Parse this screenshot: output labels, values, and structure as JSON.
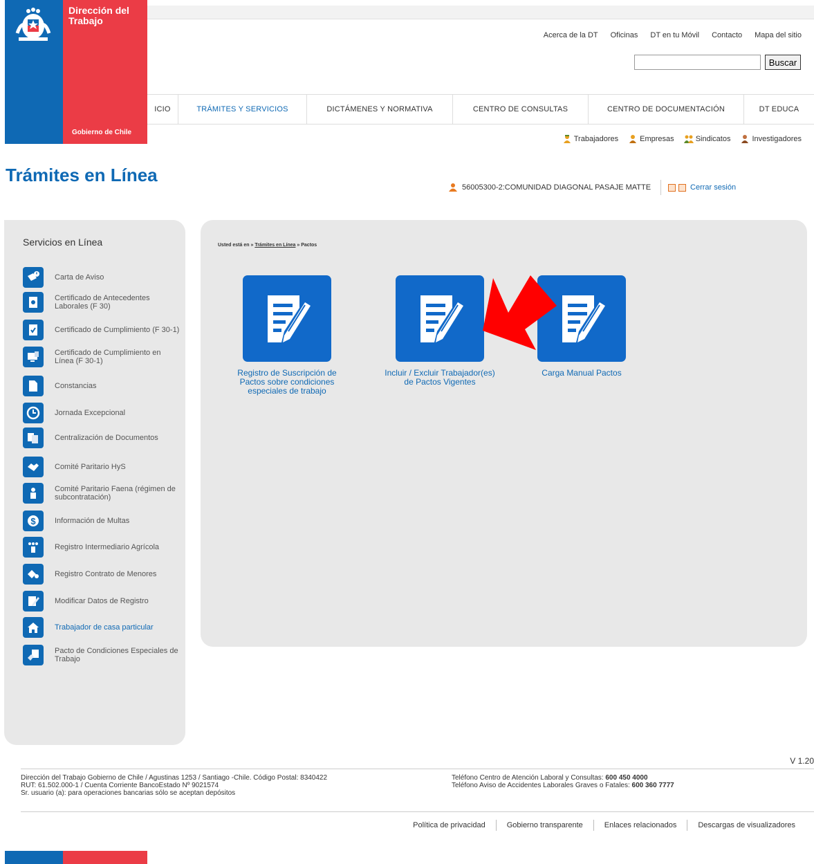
{
  "logo": {
    "line1": "Dirección del",
    "line2": "Trabajo",
    "bottom": "Gobierno de Chile"
  },
  "header": {
    "top_links": [
      "Acerca de la DT",
      "Oficinas",
      "DT en tu Móvil",
      "Contacto",
      "Mapa del sitio"
    ],
    "search": {
      "value": "",
      "button": "Buscar"
    },
    "nav": [
      {
        "label": "ICIO"
      },
      {
        "label": "TRÁMITES Y SERVICIOS"
      },
      {
        "label": "DICTÁMENES Y NORMATIVA"
      },
      {
        "label": "CENTRO DE CONSULTAS"
      },
      {
        "label": "CENTRO DE DOCUMENTACIÓN"
      },
      {
        "label": "DT EDUCA"
      }
    ],
    "audiences": [
      "Trabajadores",
      "Empresas",
      "Sindicatos",
      "Investigadores"
    ]
  },
  "page": {
    "title": "Trámites en Línea",
    "user": "56005300-2:COMUNIDAD DIAGONAL PASAJE MATTE",
    "logout": "Cerrar sesión"
  },
  "sidebar": {
    "title": "Servicios en Línea",
    "items": [
      {
        "label": "Carta de Aviso",
        "icon": "envelope-alert-icon"
      },
      {
        "label": "Certificado de Antecedentes Laborales (F 30)",
        "icon": "certificate-icon"
      },
      {
        "label": "Certificado de Cumplimiento (F 30-1)",
        "icon": "certificate-check-icon"
      },
      {
        "label": "Certificado de Cumplimiento en Línea (F 30-1)",
        "icon": "computer-certificate-icon"
      },
      {
        "label": "Constancias",
        "icon": "document-icon"
      },
      {
        "label": "Jornada Excepcional",
        "icon": "clock-icon"
      },
      {
        "label": "Centralización de Documentos",
        "icon": "documents-icon"
      },
      {
        "label": "Comité Paritario HyS",
        "icon": "handshake-icon"
      },
      {
        "label": "Comité Paritario Faena (régimen de subcontratación)",
        "icon": "worker-icon"
      },
      {
        "label": "Información de Multas",
        "icon": "dollar-icon"
      },
      {
        "label": "Registro Intermediario Agrícola",
        "icon": "people-icon"
      },
      {
        "label": "Registro Contrato de Menores",
        "icon": "children-icon"
      },
      {
        "label": "Modificar Datos de Registro",
        "icon": "edit-icon"
      },
      {
        "label": "Trabajador de casa particular",
        "icon": "house-icon"
      },
      {
        "label": "Pacto de Condiciones Especiales de Trabajo",
        "icon": "agreement-icon"
      }
    ]
  },
  "main": {
    "breadcrumb": {
      "prefix": "Usted está en »",
      "link": "Trámites en Línea",
      "current": "» Pactos"
    },
    "tiles": [
      {
        "label": "Registro de Suscripción de Pactos sobre condiciones especiales de trabajo"
      },
      {
        "label": "Incluir / Excluir Trabajador(es) de Pactos Vigentes"
      },
      {
        "label": "Carga Manual Pactos"
      }
    ],
    "arrow_color": "#ff0000"
  },
  "footer": {
    "version": "V 1.20",
    "address": [
      "Dirección del Trabajo Gobierno de Chile / Agustinas 1253 / Santiago -Chile. Código Postal: 8340422",
      "RUT: 61.502.000-1 / Cuenta Corriente BancoEstado Nº 9021574",
      "Sr. usuario (a): para operaciones bancarias sólo se aceptan depósitos"
    ],
    "phone1_label": "Teléfono Centro de Atención Laboral y Consultas:",
    "phone1": "600 450 4000",
    "phone2_label": "Teléfono Aviso de Accidentes Laborales Graves o Fatales:",
    "phone2": "600 360 7777",
    "links": [
      "Política de privacidad",
      "Gobierno transparente",
      "Enlaces relacionados",
      "Descargas de visualizadores"
    ]
  },
  "colors": {
    "brand_blue": "#0f69b4",
    "brand_red": "#eb3c46",
    "tile_blue": "#1169c9"
  }
}
